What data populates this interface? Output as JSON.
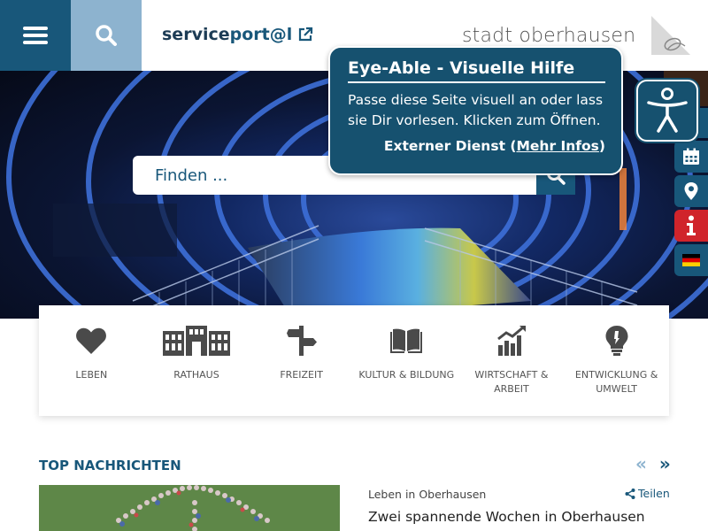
{
  "header": {
    "menu_icon": "hamburger-icon",
    "search_icon": "search-icon",
    "serviceportal": {
      "prefix": "service",
      "accent": "port@l",
      "icon": "external-link-icon"
    },
    "logo_text": "stadt oberhausen"
  },
  "hero": {
    "search_placeholder": "Finden ...",
    "search_submit_icon": "search-icon"
  },
  "tooltip": {
    "title": "Eye-Able - Visuelle Hilfe",
    "body": "Passe diese Seite visuell an oder lass sie Dir vorlesen. Klicken zum Öffnen.",
    "footer_prefix": "Externer Dienst (",
    "footer_link": "Mehr Infos",
    "footer_suffix": ")"
  },
  "eyeable_icon": "accessibility-icon",
  "rail": [
    {
      "icon": "calendar-icon",
      "color": "#18577a"
    },
    {
      "icon": "location-pin-icon",
      "color": "#18577a"
    },
    {
      "icon": "info-icon",
      "color": "#d0242b"
    },
    {
      "icon": "german-flag-icon",
      "color": "#18577a"
    }
  ],
  "categories": [
    {
      "label": "LEBEN",
      "icon": "heart-icon"
    },
    {
      "label": "RATHAUS",
      "icon": "town-hall-icon"
    },
    {
      "label": "FREIZEIT",
      "icon": "signpost-icon"
    },
    {
      "label": "KULTUR & BILDUNG",
      "icon": "book-icon"
    },
    {
      "label": "WIRTSCHAFT & ARBEIT",
      "icon": "chart-growth-icon"
    },
    {
      "label": "ENTWICKLUNG & UMWELT",
      "icon": "lightbulb-icon"
    }
  ],
  "news": {
    "title": "TOP NACHRICHTEN",
    "prev": "«",
    "next": "»",
    "item": {
      "category": "Leben in Oberhausen",
      "share_label": "Teilen",
      "headline": "Zwei spannende Wochen in Oberhausen"
    }
  },
  "colors": {
    "primary": "#18577a",
    "light": "#8db3cf",
    "red": "#d0242b"
  }
}
